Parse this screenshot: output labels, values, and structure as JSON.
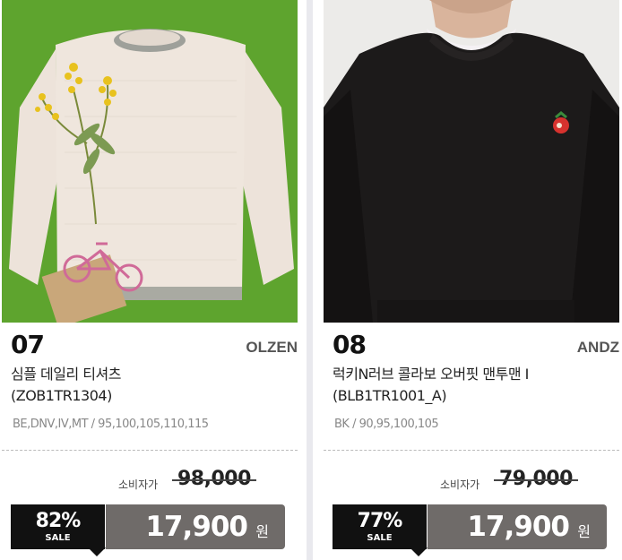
{
  "products": [
    {
      "number": "07",
      "brand": "OLZEN",
      "name_line1": "심플 데일리 티셔츠",
      "name_line2": "(ZOB1TR1304)",
      "options": "BE,DNV,IV,MT / 95,100,105,110,115",
      "original_label": "소비자가",
      "original_price": "98,000",
      "discount": "82%",
      "sale_label": "SALE",
      "price": "17,900",
      "currency": "원",
      "image_icon": "beige-knit-sweater-on-grass"
    },
    {
      "number": "08",
      "brand": "ANDZ",
      "name_line1": "럭키N러브 콜라보 오버핏 맨투맨 I",
      "name_line2": "(BLB1TR1001_A)",
      "options": "BK / 90,95,100,105",
      "original_label": "소비자가",
      "original_price": "79,000",
      "discount": "77%",
      "sale_label": "SALE",
      "price": "17,900",
      "currency": "원",
      "image_icon": "black-sweatshirt-model"
    }
  ],
  "colors": {
    "badge": "#111111",
    "price_box": "#6f6b69",
    "grass": "#5aa02c"
  }
}
